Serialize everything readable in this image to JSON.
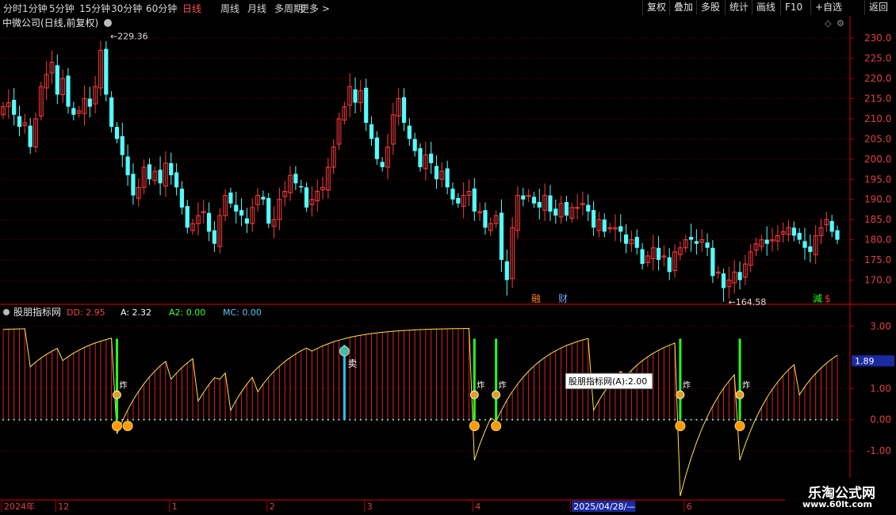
{
  "toolbar": {
    "timeframes": [
      "分时",
      "1分钟",
      "5分钟",
      "15分钟",
      "30分钟",
      "60分钟",
      "日线",
      "周线",
      "月线",
      "多周期",
      "更多 >"
    ],
    "active": "日线",
    "right_buttons": [
      "复权",
      "叠加",
      "多股",
      "统计",
      "画线",
      "F10",
      "+自选",
      "返回"
    ]
  },
  "colors": {
    "up": "#ff3b3b",
    "down": "#54ffff",
    "grid": "#7a0000",
    "yellow": "#ffe54a",
    "green": "#22ff22"
  },
  "chart_data": [
    {
      "type": "candlestick",
      "title": "中微公司(日线,前复权)",
      "ylim": [
        164,
        232
      ],
      "yticks": [
        170,
        175,
        180,
        185,
        190,
        195,
        200,
        205,
        210,
        215,
        220,
        225,
        230
      ],
      "annotations": {
        "high": "229.36",
        "low": "164.58",
        "markers": [
          "融",
          "财",
          "減",
          "$"
        ]
      },
      "closes": [
        213,
        214,
        211,
        208,
        209,
        203,
        210,
        218,
        221,
        224,
        216,
        220,
        213,
        211,
        212,
        215,
        213,
        218,
        227,
        216,
        208,
        205,
        201,
        196,
        191,
        193,
        198,
        195,
        197,
        194,
        199,
        196,
        193,
        188,
        183,
        184,
        186,
        187,
        182,
        179,
        186,
        191,
        189,
        187,
        186,
        184,
        188,
        191,
        190,
        184,
        185,
        190,
        192,
        196,
        194,
        193,
        188,
        190,
        192,
        193,
        198,
        203,
        210,
        213,
        218,
        214,
        217,
        209,
        205,
        200,
        198,
        203,
        211,
        215,
        209,
        205,
        202,
        198,
        201,
        199,
        195,
        197,
        193,
        190,
        189,
        191,
        192,
        187,
        187,
        183,
        184,
        186,
        175,
        170,
        183,
        191,
        190,
        191,
        189,
        188,
        191,
        187,
        186,
        189,
        186,
        188,
        188,
        189,
        187,
        183,
        185,
        182,
        183,
        183,
        182,
        179,
        180,
        178,
        174,
        176,
        178,
        175,
        176,
        172,
        177,
        178,
        180,
        180,
        179,
        180,
        178,
        171,
        172,
        168,
        170,
        172,
        170,
        174,
        177,
        179,
        180,
        179,
        180,
        181,
        182,
        183,
        181,
        180,
        178,
        177,
        181,
        183,
        185,
        182,
        180
      ]
    },
    {
      "type": "indicator",
      "title": "股朋指标网",
      "legend": [
        {
          "name": "DD",
          "value": "2.95"
        },
        {
          "name": "A",
          "value": "2.32"
        },
        {
          "name": "A2",
          "value": "0.00"
        },
        {
          "name": "MC",
          "value": "0.00"
        }
      ],
      "ylim": [
        -2.55,
        3.3
      ],
      "yticks": [
        "3.00",
        "1.00",
        "0.00",
        "-1.00"
      ],
      "ytick_values": [
        3,
        1,
        0,
        -1
      ],
      "current_value": "1.89",
      "tooltip": "股朋指标网(A):2.00",
      "signal_labels": [
        "炸",
        "卖"
      ],
      "buy_signal_bars": [
        21,
        87,
        91,
        125,
        136
      ],
      "extra_marker_bars": [
        23
      ],
      "sell_signal_bar": 63,
      "x_axis_labels": [
        "2024年",
        "12",
        "1",
        "2",
        "3",
        "4",
        "2025/04/28/—",
        "6"
      ],
      "x_axis_bars": [
        0,
        10,
        31,
        49,
        67,
        87,
        105,
        126
      ]
    }
  ]
}
